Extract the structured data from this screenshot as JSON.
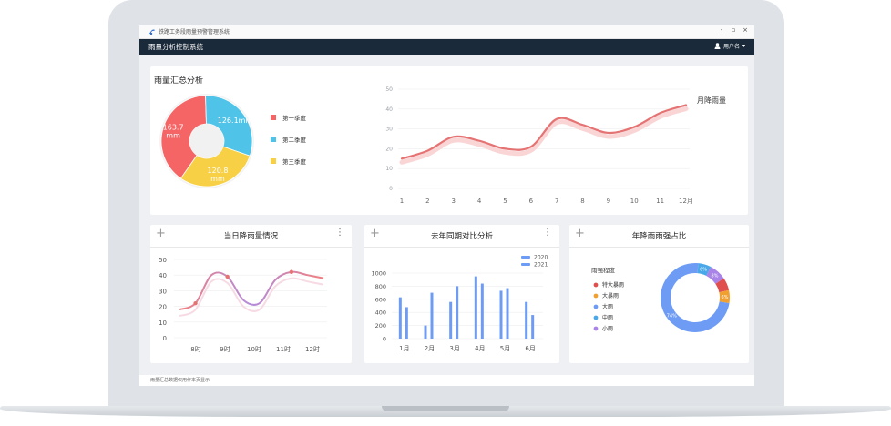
{
  "window": {
    "title": "铁路工务段雨量预警管理系统",
    "minimize": "-",
    "restore": "▫",
    "close": "×"
  },
  "app": {
    "title": "雨量分析控制系统",
    "user": "用户名"
  },
  "summary": {
    "title": "雨量汇总分析",
    "legend": [
      {
        "label": "第一季度",
        "color": "#f56565"
      },
      {
        "label": "第二季度",
        "color": "#4fc3e8"
      },
      {
        "label": "第三季度",
        "color": "#f7d046"
      }
    ]
  },
  "cards": {
    "daily": {
      "title": "当日降雨量情况"
    },
    "compare": {
      "title": "去年同期对比分析"
    },
    "intensity": {
      "title": "年降雨雨强占比"
    }
  },
  "footer": {
    "text": "雨量汇总数据仅用作本页显示"
  },
  "chart_data": [
    {
      "type": "pie",
      "title": "",
      "slices": [
        {
          "label": "第一季度",
          "value": 163.7,
          "display": "163.7\nmm",
          "color": "#f56565"
        },
        {
          "label": "第二季度",
          "value": 126.1,
          "display": "126.1mm",
          "color": "#4fc3e8"
        },
        {
          "label": "第三季度",
          "value": 120.8,
          "display": "120.8\nmm",
          "color": "#f7d046"
        }
      ],
      "donut": true
    },
    {
      "type": "line",
      "title": "月降雨量",
      "categories": [
        "1",
        "2",
        "3",
        "4",
        "5",
        "6",
        "7",
        "8",
        "9",
        "10",
        "11",
        "12月"
      ],
      "values": [
        15,
        19,
        26,
        24,
        20,
        21,
        35,
        32,
        28,
        31,
        38,
        42
      ],
      "ylim": [
        0,
        50
      ],
      "yticks": [
        0,
        10,
        20,
        30,
        40,
        50
      ],
      "color": "#e57373",
      "smooth": true,
      "grid": true
    },
    {
      "type": "line",
      "title": "",
      "x_labels": [
        "8时",
        "9时",
        "10时",
        "11时",
        "12时"
      ],
      "values": [
        18,
        22,
        40,
        39,
        24,
        22,
        37,
        42,
        40,
        38
      ],
      "ylim": [
        0,
        50
      ],
      "yticks": [
        0,
        10,
        20,
        30,
        40,
        50
      ],
      "gradient": [
        "#f08080",
        "#b48cdc"
      ],
      "smooth": true,
      "grid": true
    },
    {
      "type": "bar",
      "categories": [
        "1月",
        "2月",
        "3月",
        "4月",
        "5月",
        "6月"
      ],
      "series": [
        {
          "name": "2020",
          "values": [
            630,
            200,
            560,
            950,
            730,
            560
          ],
          "color": "#6e9cf5"
        },
        {
          "name": "2021",
          "values": [
            480,
            700,
            800,
            840,
            770,
            360
          ],
          "color": "#6e9cf5"
        }
      ],
      "ylim": [
        0,
        1000
      ],
      "yticks": [
        0,
        200,
        400,
        600,
        800,
        1000
      ],
      "legend_position": "top-right",
      "grid": true
    },
    {
      "type": "pie",
      "donut": true,
      "title": "雨强程度",
      "slices": [
        {
          "label": "特大暴雨",
          "value": 6,
          "color": "#e04e4e",
          "display": ""
        },
        {
          "label": "大暴雨",
          "value": 6,
          "color": "#f0a030",
          "display": "6%"
        },
        {
          "label": "大雨",
          "value": 74,
          "color": "#6e9cf5",
          "display": "74%"
        },
        {
          "label": "中雨",
          "value": 6,
          "color": "#4aa8e8",
          "display": "6%"
        },
        {
          "label": "小雨",
          "value": 8,
          "color": "#a983e8",
          "display": "8%"
        }
      ]
    }
  ]
}
